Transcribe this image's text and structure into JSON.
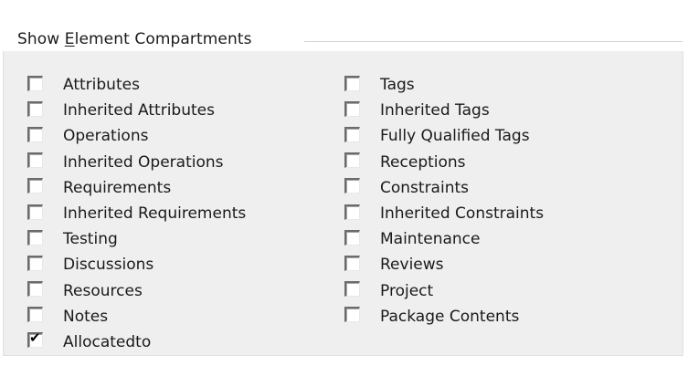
{
  "group": {
    "title_pre": "Show ",
    "title_mnemonic": "E",
    "title_post": "lement Compartments"
  },
  "left_column": [
    {
      "label": "Attributes",
      "checked": false
    },
    {
      "label": "Inherited Attributes",
      "checked": false
    },
    {
      "label": "Operations",
      "checked": false
    },
    {
      "label": "Inherited Operations",
      "checked": false
    },
    {
      "label": "Requirements",
      "checked": false
    },
    {
      "label": "Inherited Requirements",
      "checked": false
    },
    {
      "label": "Testing",
      "checked": false
    },
    {
      "label": "Discussions",
      "checked": false
    },
    {
      "label": "Resources",
      "checked": false
    },
    {
      "label": "Notes",
      "checked": false
    },
    {
      "label": "Allocatedto",
      "checked": true
    }
  ],
  "right_column": [
    {
      "label": "Tags",
      "checked": false
    },
    {
      "label": "Inherited Tags",
      "checked": false
    },
    {
      "label": "Fully Qualified Tags",
      "checked": false
    },
    {
      "label": "Receptions",
      "checked": false
    },
    {
      "label": "Constraints",
      "checked": false
    },
    {
      "label": "Inherited Constraints",
      "checked": false
    },
    {
      "label": "Maintenance",
      "checked": false
    },
    {
      "label": "Reviews",
      "checked": false
    },
    {
      "label": "Project",
      "checked": false
    },
    {
      "label": "Package Contents",
      "checked": false
    }
  ],
  "check_glyph": "✔"
}
